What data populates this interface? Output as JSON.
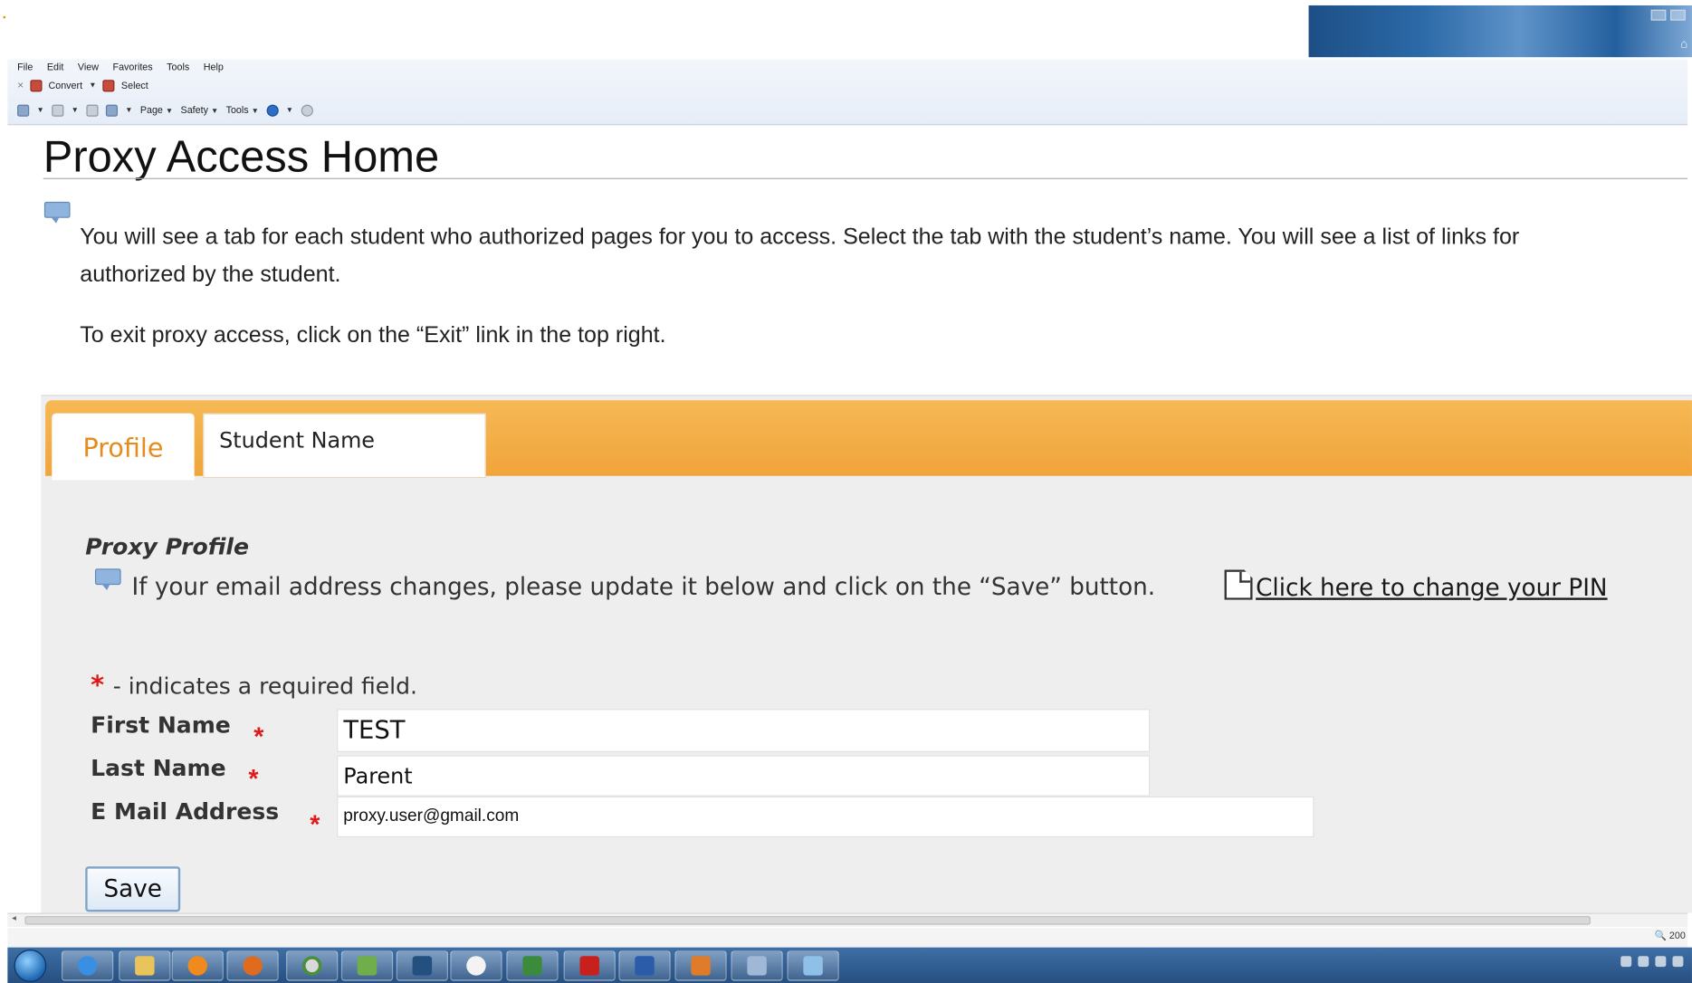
{
  "browser": {
    "menu": [
      "File",
      "Edit",
      "View",
      "Favorites",
      "Tools",
      "Help"
    ],
    "convert_label": "Convert",
    "select_label": "Select",
    "command_bar": [
      "Page",
      "Safety",
      "Tools"
    ],
    "zoom_text": "200"
  },
  "page": {
    "title": "Proxy Access Home",
    "intro_line1": "You will see a tab for each student who authorized pages for you to access. Select the tab with the student’s name. You will see a list of links for",
    "intro_line2": "authorized by the student.",
    "exit_text": "To exit proxy access, click on the “Exit” link in the top right."
  },
  "tabs": [
    {
      "label": "Profile",
      "active": true
    },
    {
      "label": "Student Name",
      "active": false
    }
  ],
  "profile": {
    "section_title": "Proxy Profile",
    "email_hint": "If your email address changes, please update it below and click on the “Save” button.",
    "pin_link": "Click here to change your PIN",
    "required_note": "- indicates a required field.",
    "required_marker": "*",
    "fields": [
      {
        "label": "First Name",
        "value": "TEST"
      },
      {
        "label": "Last Name",
        "value": "Parent"
      },
      {
        "label": "E Mail Address",
        "value": "proxy.user@gmail.com"
      }
    ],
    "save_label": "Save"
  },
  "colors": {
    "tab_strip": "#f1a43a",
    "active_tab_text": "#e58c1c",
    "required": "#e01a1a",
    "taskbar": "#274f80"
  },
  "taskbar_apps": [
    "internet-explorer-icon",
    "folder-icon",
    "media-player-icon",
    "firefox-icon",
    "chrome-icon",
    "photos-icon",
    "amazon-icon",
    "messenger-icon",
    "excel-icon",
    "acrobat-icon",
    "word-icon",
    "java-icon",
    "database-icon",
    "notes-icon"
  ]
}
